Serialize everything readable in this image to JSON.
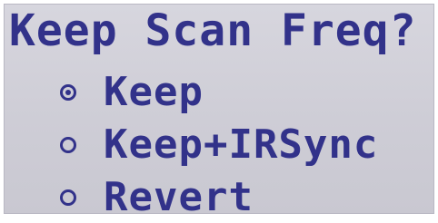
{
  "screen": {
    "title": "Keep Scan Freq?",
    "options": [
      {
        "label": "Keep",
        "selected": true
      },
      {
        "label": "Keep+IRSync",
        "selected": false
      },
      {
        "label": "Revert",
        "selected": false
      }
    ]
  },
  "colors": {
    "text": "#32328a",
    "background": "#cfcfd8"
  }
}
